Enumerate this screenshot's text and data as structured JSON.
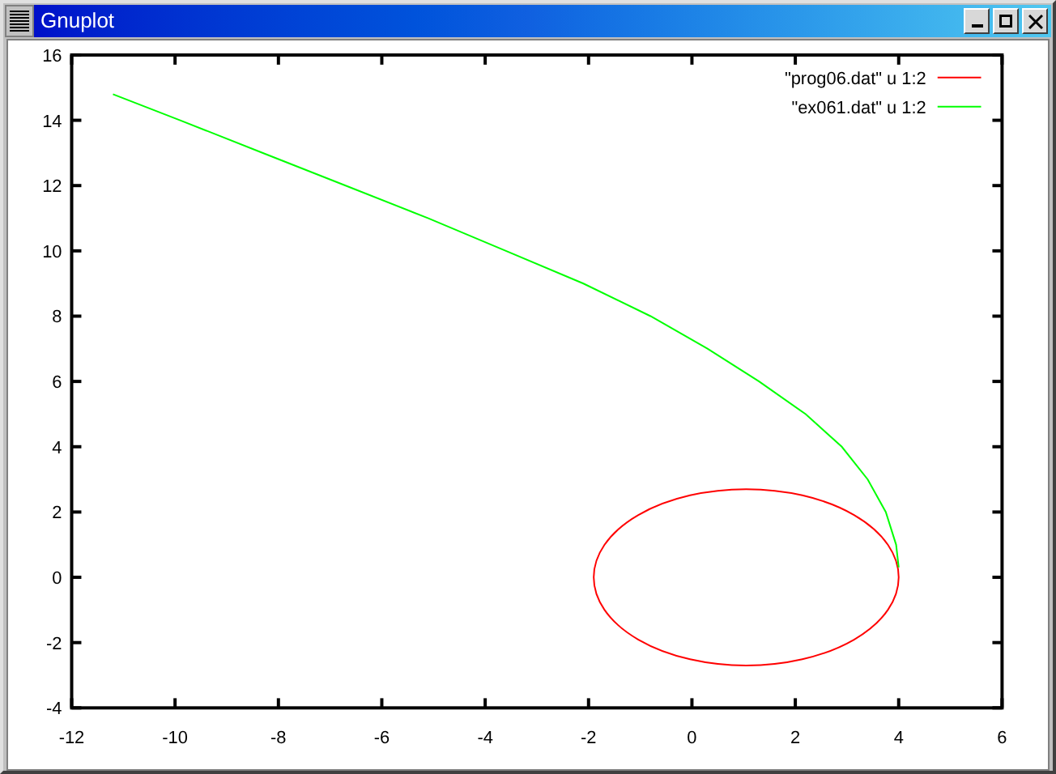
{
  "window": {
    "title": "Gnuplot"
  },
  "plot": {
    "chart_data": {
      "type": "line",
      "xlim": [
        -12,
        6
      ],
      "ylim": [
        -4,
        16
      ],
      "xticks": [
        -12,
        -10,
        -8,
        -6,
        -4,
        -2,
        0,
        2,
        4,
        6
      ],
      "yticks": [
        -4,
        -2,
        0,
        2,
        4,
        6,
        8,
        10,
        12,
        14,
        16
      ],
      "legend": true,
      "series": [
        {
          "name": "\"prog06.dat\" u 1:2",
          "color": "#ff0000"
        },
        {
          "name": "\"ex061.dat\" u 1:2",
          "color": "#00ff00",
          "x": [
            -11.2,
            -9.9,
            -8.3,
            -6.7,
            -5.1,
            -3.6,
            -2.1,
            -0.8,
            0.3,
            1.3,
            2.2,
            2.9,
            3.4,
            3.75,
            3.95,
            4.0
          ],
          "values": [
            14.8,
            14,
            13,
            12,
            11,
            10,
            9,
            8,
            7,
            6,
            5,
            4,
            3,
            2,
            1,
            0.3
          ]
        }
      ]
    }
  }
}
